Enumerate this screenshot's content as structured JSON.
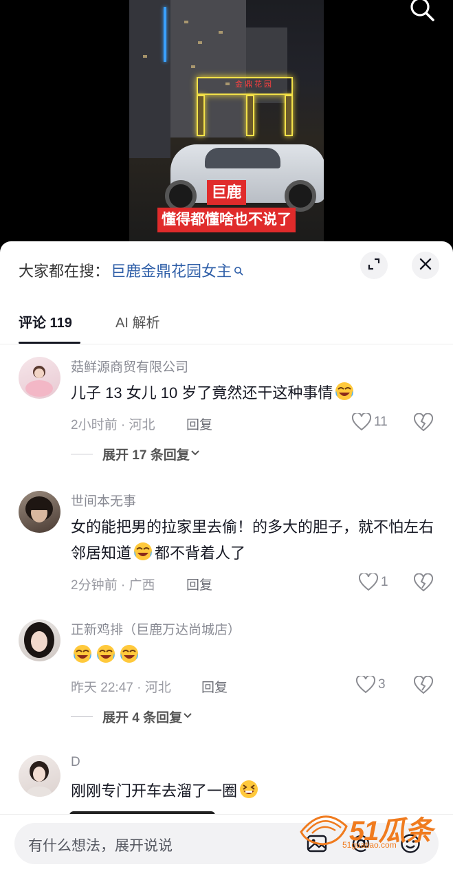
{
  "video": {
    "sign_text": "金鼎花园",
    "caption_line1": "巨鹿",
    "caption_line2": "懂得都懂啥也不说了",
    "search_icon": "search-icon"
  },
  "search_hint": {
    "prefix": "大家都在搜：",
    "query": "巨鹿金鼎花园女主"
  },
  "tabs": [
    {
      "label": "评论 119",
      "active": true
    },
    {
      "label": "AI 解析",
      "active": false
    }
  ],
  "comments": [
    {
      "username": "菇鲜源商贸有限公司",
      "text": "儿子 13 女儿 10 岁了竟然还干这种事情",
      "emojis": [
        "laugh-cry"
      ],
      "time_location": "2小时前 · 河北",
      "reply_label": "回复",
      "likes": "11",
      "expand_label": "展开 17 条回复"
    },
    {
      "username": "世间本无事",
      "text_before": "女的能把男的拉家里去偷！的多大的胆子，就不怕左右邻居知道",
      "text_after": "都不背着人了",
      "emojis": [
        "laugh-cry"
      ],
      "time_location": "2分钟前 · 广西",
      "reply_label": "回复",
      "likes": "1"
    },
    {
      "username": "正新鸡排（巨鹿万达尚城店）",
      "text": "",
      "emojis": [
        "laugh-cry",
        "laugh-cry",
        "laugh-cry"
      ],
      "time_location": "昨天 22:47 · 河北",
      "reply_label": "回复",
      "likes": "3",
      "expand_label": "展开 4 条回复"
    },
    {
      "username": "D",
      "text": "刚刚专门开车去溜了一圈",
      "emojis": [
        "grin-squint"
      ]
    }
  ],
  "bottom_bar": {
    "placeholder": "有什么想法，展开说说",
    "icons": [
      "image-icon",
      "at-icon",
      "emoji-icon"
    ]
  },
  "watermark": {
    "text": "51瓜条",
    "url": "51guatiao.com"
  },
  "colors": {
    "link_blue": "#2f5fa8",
    "caption_red": "#e02b2b",
    "watermark_orange": "#f07b1e"
  }
}
